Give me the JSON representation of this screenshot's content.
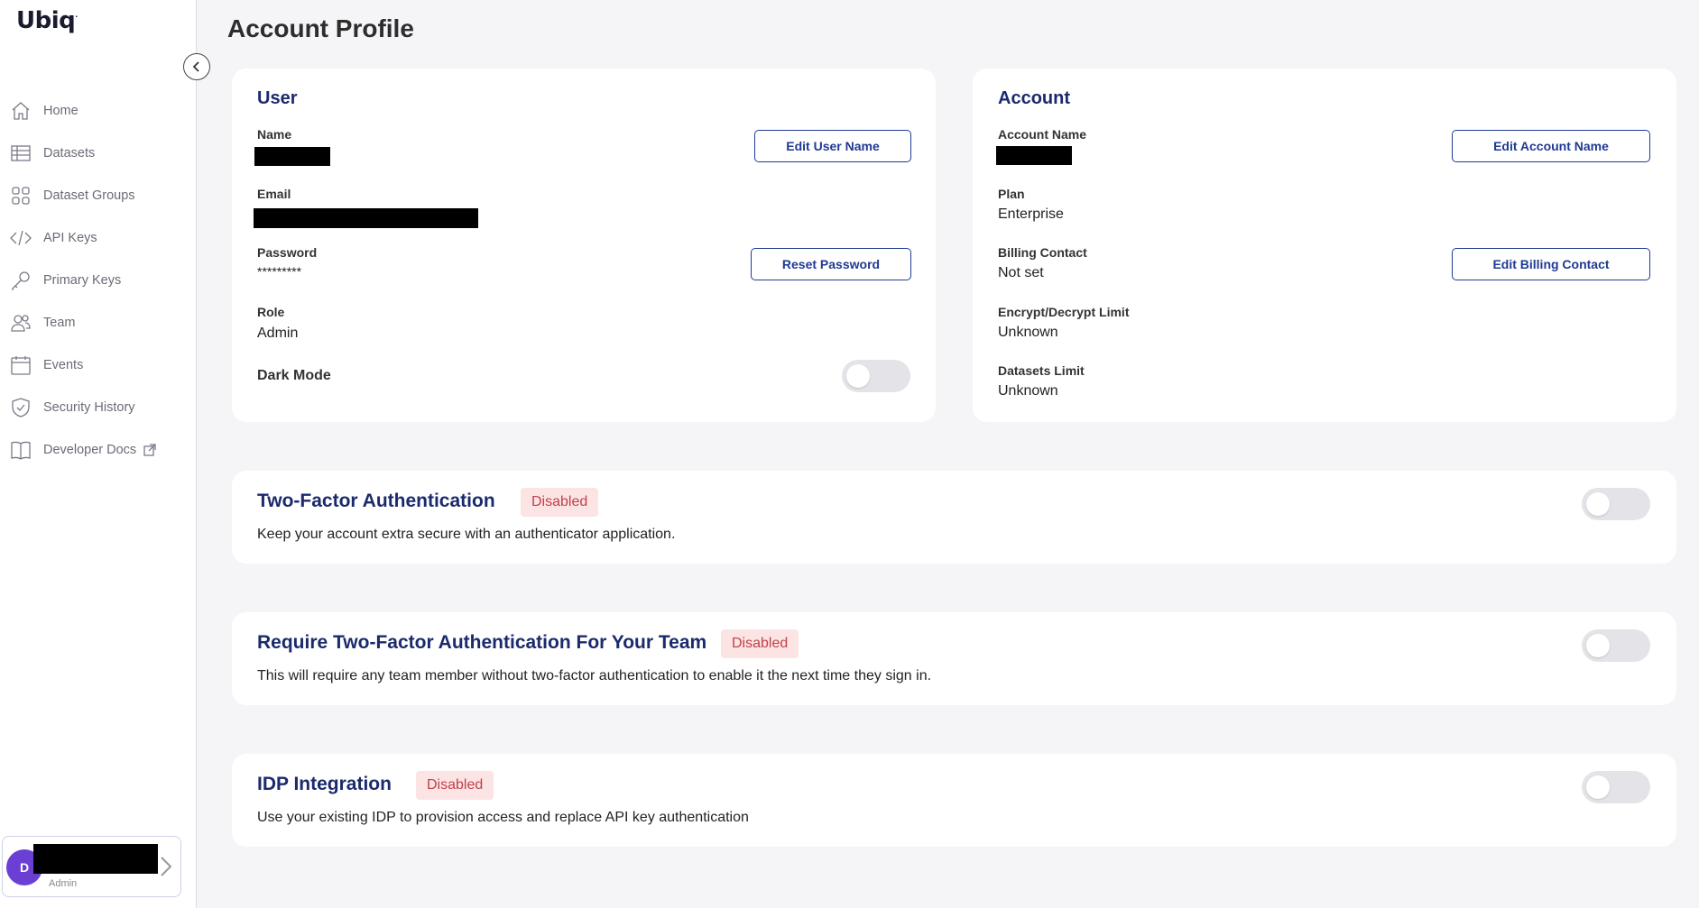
{
  "app": {
    "logo_text": "Ubiq",
    "logo_mark": "·"
  },
  "sidebar": {
    "items": [
      {
        "label": "Home",
        "icon": "home-icon"
      },
      {
        "label": "Datasets",
        "icon": "table-icon"
      },
      {
        "label": "Dataset Groups",
        "icon": "grid-icon"
      },
      {
        "label": "API Keys",
        "icon": "code-icon"
      },
      {
        "label": "Primary Keys",
        "icon": "key-icon"
      },
      {
        "label": "Team",
        "icon": "team-icon"
      },
      {
        "label": "Events",
        "icon": "calendar-icon"
      },
      {
        "label": "Security History",
        "icon": "shield-icon"
      },
      {
        "label": "Developer Docs",
        "icon": "book-icon"
      }
    ],
    "user": {
      "initial": "D",
      "role": "Admin"
    }
  },
  "page": {
    "title": "Account Profile"
  },
  "user_card": {
    "title": "User",
    "name_label": "Name",
    "edit_name_button": "Edit User Name",
    "email_label": "Email",
    "password_label": "Password",
    "password_value": "*********",
    "reset_password_button": "Reset Password",
    "role_label": "Role",
    "role_value": "Admin",
    "dark_mode_label": "Dark Mode",
    "dark_mode_enabled": false
  },
  "account_card": {
    "title": "Account",
    "account_name_label": "Account Name",
    "edit_account_button": "Edit Account Name",
    "plan_label": "Plan",
    "plan_value": "Enterprise",
    "billing_label": "Billing Contact",
    "billing_value": "Not set",
    "edit_billing_button": "Edit Billing Contact",
    "encrypt_label": "Encrypt/Decrypt Limit",
    "encrypt_value": "Unknown",
    "datasets_label": "Datasets Limit",
    "datasets_value": "Unknown"
  },
  "features": [
    {
      "title": "Two-Factor Authentication",
      "status": "Disabled",
      "description": "Keep your account extra secure with an authenticator application.",
      "enabled": false
    },
    {
      "title": "Require Two-Factor Authentication For Your Team",
      "status": "Disabled",
      "description": "This will require any team member without two-factor authentication to enable it the next time they sign in.",
      "enabled": false
    },
    {
      "title": "IDP Integration",
      "status": "Disabled",
      "description": "Use your existing IDP to provision access and replace API key authentication",
      "enabled": false
    }
  ],
  "colors": {
    "accent": "#1f3a93",
    "title": "#1a2a6c",
    "badge_bg": "#fde4e4",
    "badge_text": "#c0404a",
    "avatar": "#6b3fd4"
  }
}
